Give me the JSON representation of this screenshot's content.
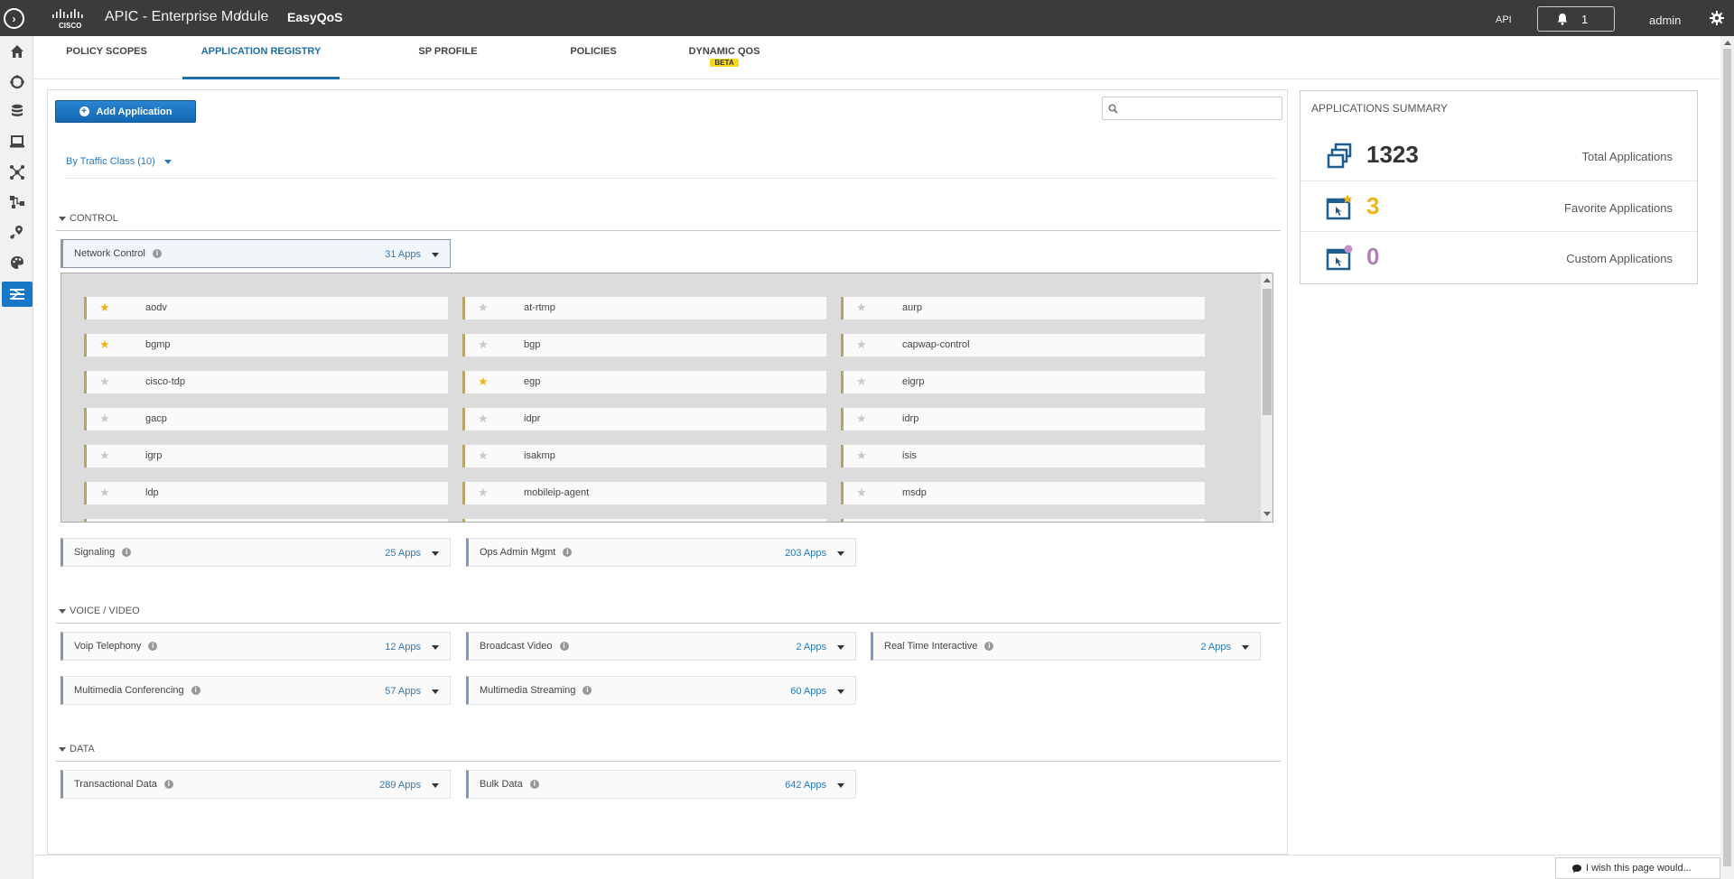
{
  "topbar": {
    "app_title": "APIC - Enterprise Module",
    "separator": "/",
    "breadcrumb": "EasyQoS",
    "api_label": "API",
    "notification_count": "1",
    "user": "admin"
  },
  "tabs": [
    {
      "label": "POLICY SCOPES"
    },
    {
      "label": "APPLICATION REGISTRY",
      "active": true
    },
    {
      "label": "SP PROFILE"
    },
    {
      "label": "POLICIES"
    },
    {
      "label": "DYNAMIC QOS",
      "badge": "BETA"
    }
  ],
  "toolbar": {
    "add_label": "Add Application",
    "search_placeholder": "",
    "group_by": "By Traffic Class (10)"
  },
  "sections": {
    "control": "CONTROL",
    "voice_video": "VOICE / VIDEO",
    "data": "DATA"
  },
  "categories": {
    "network_control": {
      "name": "Network Control",
      "count": "31 Apps"
    },
    "signaling": {
      "name": "Signaling",
      "count": "25 Apps"
    },
    "ops_admin": {
      "name": "Ops Admin Mgmt",
      "count": "203 Apps"
    },
    "voip": {
      "name": "Voip Telephony",
      "count": "12 Apps"
    },
    "broadcast": {
      "name": "Broadcast Video",
      "count": "2 Apps"
    },
    "realtime": {
      "name": "Real Time Interactive",
      "count": "2 Apps"
    },
    "mm_conf": {
      "name": "Multimedia Conferencing",
      "count": "57 Apps"
    },
    "mm_stream": {
      "name": "Multimedia Streaming",
      "count": "60 Apps"
    },
    "transactional": {
      "name": "Transactional Data",
      "count": "289 Apps"
    },
    "bulk": {
      "name": "Bulk Data",
      "count": "642 Apps"
    }
  },
  "network_control_apps": [
    {
      "name": "aodv",
      "favorite": true
    },
    {
      "name": "at-rtmp",
      "favorite": false
    },
    {
      "name": "aurp",
      "favorite": false
    },
    {
      "name": "bgmp",
      "favorite": true
    },
    {
      "name": "bgp",
      "favorite": false
    },
    {
      "name": "capwap-control",
      "favorite": false
    },
    {
      "name": "cisco-tdp",
      "favorite": false
    },
    {
      "name": "egp",
      "favorite": true
    },
    {
      "name": "eigrp",
      "favorite": false
    },
    {
      "name": "gacp",
      "favorite": false
    },
    {
      "name": "idpr",
      "favorite": false
    },
    {
      "name": "idrp",
      "favorite": false
    },
    {
      "name": "igrp",
      "favorite": false
    },
    {
      "name": "isakmp",
      "favorite": false
    },
    {
      "name": "isis",
      "favorite": false
    },
    {
      "name": "ldp",
      "favorite": false
    },
    {
      "name": "mobileip-agent",
      "favorite": false
    },
    {
      "name": "msdp",
      "favorite": false
    }
  ],
  "summary": {
    "title": "APPLICATIONS SUMMARY",
    "total": {
      "value": "1323",
      "label": "Total Applications",
      "color": "#333333"
    },
    "favorite": {
      "value": "3",
      "label": "Favorite Applications",
      "color": "#f0b31a"
    },
    "custom": {
      "value": "0",
      "label": "Custom Applications",
      "color": "#b07fb5"
    }
  },
  "feedback": "I wish this page would..."
}
